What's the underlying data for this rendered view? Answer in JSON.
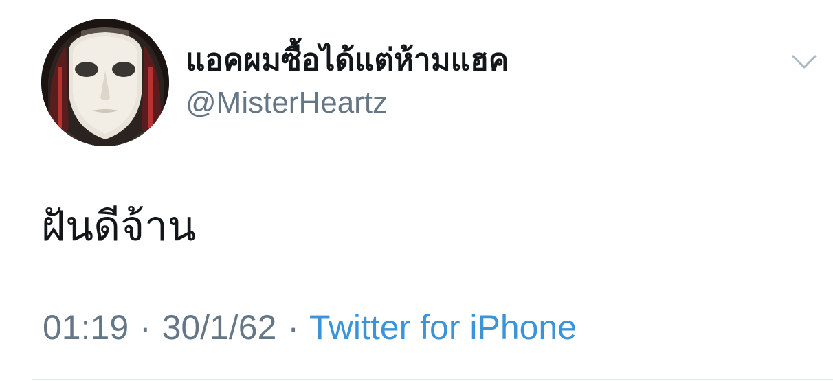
{
  "tweet": {
    "author": {
      "display_name": "แอคผมซื้อได้แต่ห้ามแฮค",
      "handle": "@MisterHeartz",
      "avatar_icon": "white-mask-avatar"
    },
    "text": "ฝันดีจ้าน",
    "time": "01:19",
    "date": "30/1/62",
    "separator": "·",
    "source": "Twitter for iPhone",
    "menu_icon": "chevron-down-icon"
  },
  "colors": {
    "primary_text": "#14171a",
    "secondary_text": "#657786",
    "link": "#3b94d9",
    "divider": "#e1e8ed"
  }
}
